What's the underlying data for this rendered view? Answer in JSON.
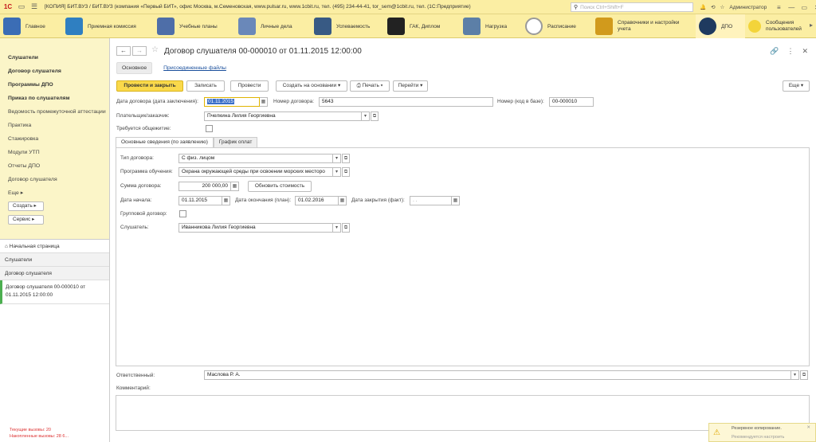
{
  "app": {
    "logo": "1С",
    "title": "[КОПИЯ] БИТ.ВУЗ / БИТ.ВУЗ (компания «Первый БИТ», офис Москва, м.Семеновская, www.pulsar.ru, www.1cbit.ru, тел. (495) 234-44-41, tor_sem@1cbit.ru, тел.  (1С:Предприятие)",
    "search_placeholder": "Поиск Ctrl+Shift+F",
    "user": "Администратор"
  },
  "sections": [
    {
      "label": "Главное",
      "color": "#3b6db5"
    },
    {
      "label": "Приемная комиссия",
      "color": "#2f7fc1"
    },
    {
      "label": "Учебные планы",
      "color": "#4e6ea8"
    },
    {
      "label": "Личные дела",
      "color": "#6a88b9"
    },
    {
      "label": "Успеваемость",
      "color": "#385a84"
    },
    {
      "label": "ГАК, Диплом",
      "color": "#222222"
    },
    {
      "label": "Нагрузка",
      "color": "#5c7fa7"
    },
    {
      "label": "Расписание",
      "color": "#9a9a9a"
    },
    {
      "label": "Справочники и настройки учета",
      "color": "#d19a1c"
    },
    {
      "label": "ДПО",
      "color": "#1f3a5f"
    },
    {
      "label": "Сообщения пользователей",
      "color": "#f3d43a"
    }
  ],
  "leftnav": {
    "items": [
      {
        "label": "Слушатели",
        "bold": true
      },
      {
        "label": "Договор слушателя",
        "bold": true
      },
      {
        "label": "Программы ДПО",
        "bold": true
      },
      {
        "label": "Приказ по слушателям",
        "bold": true
      },
      {
        "label": "Ведомость промежуточной аттестации",
        "bold": false
      },
      {
        "label": "Практика",
        "bold": false
      },
      {
        "label": "Стажировка",
        "bold": false
      },
      {
        "label": "Модули УТП",
        "bold": false
      },
      {
        "label": "Отчеты ДПО",
        "bold": false
      },
      {
        "label": "Договор слушателя",
        "bold": false
      }
    ],
    "more": "Еще",
    "create": "Создать",
    "service": "Сервис"
  },
  "history": {
    "home": "Начальная страница",
    "items": [
      "Слушатели",
      "Договор слушателя"
    ],
    "current": "Договор слушателя 00-000010 от 01.11.2015 12:00:00"
  },
  "status": {
    "current_calls": "Текущие вызовы: 20",
    "accumulated_calls": "Накопленные вызовы: 28 6..."
  },
  "form": {
    "title": "Договор слушателя 00-000010 от 01.11.2015 12:00:00",
    "tabs": [
      "Основное",
      "Присоединенные файлы"
    ],
    "toolbar": {
      "post_close": "Провести и закрыть",
      "save": "Записать",
      "post": "Провести",
      "create_based": "Создать на основании",
      "print": "Печать",
      "goto": "Перейти",
      "more": "Еще"
    },
    "fields": {
      "contract_date_label": "Дата договора (дата заключения):",
      "contract_date": "01.11.2015",
      "contract_number_label": "Номер договора:",
      "contract_number": "5643",
      "base_number_label": "Номер (код в базе):",
      "base_number": "00-000010",
      "payer_label": "Плательщик/заказчик:",
      "payer": "Пчелкина Лилия Георгиевна",
      "dormitory_label": "Требуется общежитие:"
    },
    "inner_tabs": [
      "Основные сведения (по заявлению)",
      "График оплат"
    ],
    "details": {
      "contract_type_label": "Тип договора:",
      "contract_type": "С физ. лицом",
      "program_label": "Программа обучения:",
      "program": "Охрана окружающей среды при освоении морских месторо",
      "amount_label": "Сумма договора:",
      "amount": "200 000,00",
      "update_cost": "Обновить стоимость",
      "start_date_label": "Дата начала:",
      "start_date": "01.11.2015",
      "end_plan_label": "Дата окончания (план):",
      "end_plan": "01.02.2016",
      "close_fact_label": "Дата закрытия (факт):",
      "close_fact": " .  .    ",
      "group_label": "Групповой договор:",
      "listener_label": "Слушатель:",
      "listener": "Иванникова Лилия Георгиевна"
    },
    "responsible_label": "Ответственный:",
    "responsible": "Маслова Р. А.",
    "comment_label": "Комментарий:"
  },
  "toast": {
    "line1": "Резервное копирование.",
    "line2": "Рекомендуется настроить"
  }
}
